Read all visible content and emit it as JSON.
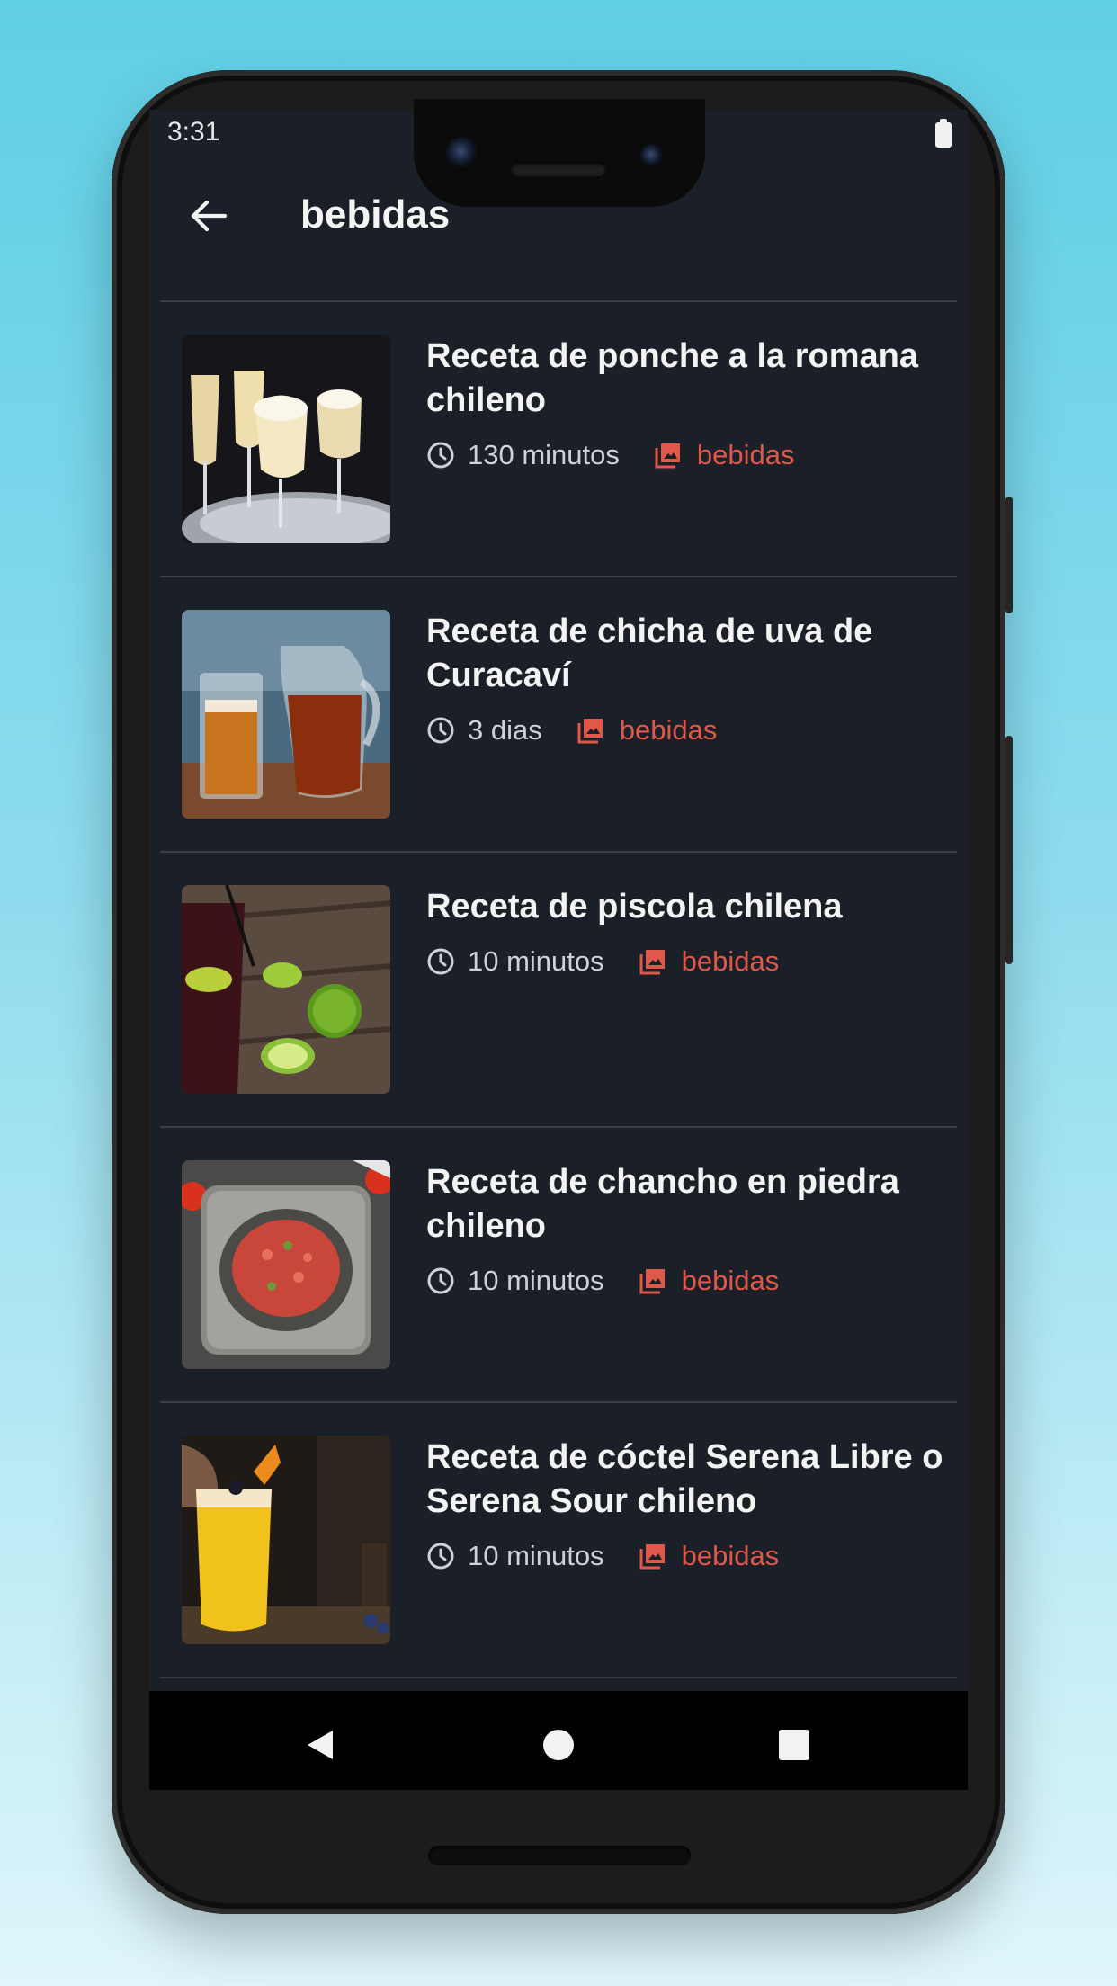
{
  "status_bar": {
    "time": "3:31"
  },
  "app_bar": {
    "title": "bebidas",
    "back_icon": "arrow-left-icon"
  },
  "recipes": [
    {
      "title": "Receta de ponche a la romana chileno",
      "time": "130 minutos",
      "category": "bebidas"
    },
    {
      "title": "Receta de chicha de uva de Curacaví",
      "time": "3 dias",
      "category": "bebidas"
    },
    {
      "title": "Receta de piscola chilena",
      "time": "10 minutos",
      "category": "bebidas"
    },
    {
      "title": "Receta de chancho en piedra chileno",
      "time": "10 minutos",
      "category": "bebidas"
    },
    {
      "title": "Receta de cóctel Serena Libre o Serena Sour chileno",
      "time": "10 minutos",
      "category": "bebidas"
    }
  ],
  "colors": {
    "background": "#1b1f27",
    "accent": "#e0584a",
    "text_primary": "#f3f3f3",
    "text_secondary": "#cfd1d6"
  },
  "nav_bar": {
    "back_icon": "triangle-back-icon",
    "home_icon": "circle-home-icon",
    "recents_icon": "square-recents-icon"
  }
}
